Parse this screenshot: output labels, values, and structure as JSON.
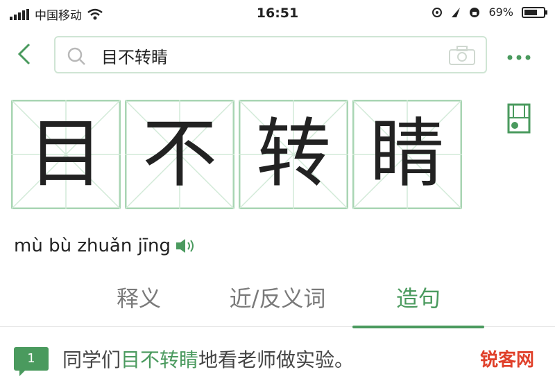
{
  "status_bar": {
    "carrier": "中国移动",
    "time": "16:51",
    "battery": "69%",
    "battery_level": 0.69,
    "icons": [
      "signal-icon",
      "wifi-icon",
      "location-icon",
      "alarm-icon",
      "lock-rotation-icon",
      "battery-icon"
    ]
  },
  "header": {
    "back_icon": "chevron-left-icon",
    "search_value": "目不转睛",
    "search_icon": "search-icon",
    "camera_icon": "camera-icon",
    "more_icon": "more-dots-icon"
  },
  "characters": [
    "目",
    "不",
    "转",
    "睛"
  ],
  "pinyin": "mù bù zhuǎn jīng",
  "tabs": [
    {
      "label": "释义",
      "active": false
    },
    {
      "label": "近/反义词",
      "active": false
    },
    {
      "label": "造句",
      "active": true
    }
  ],
  "example": {
    "badge": "1",
    "before": "同学们",
    "highlight": "目不转睛",
    "after": "地看老师做实验。"
  },
  "watermark": "锐客网",
  "colors": {
    "accent": "#4a9a5e",
    "grid": "#bfe0c7",
    "watermark": "#e0402a"
  }
}
